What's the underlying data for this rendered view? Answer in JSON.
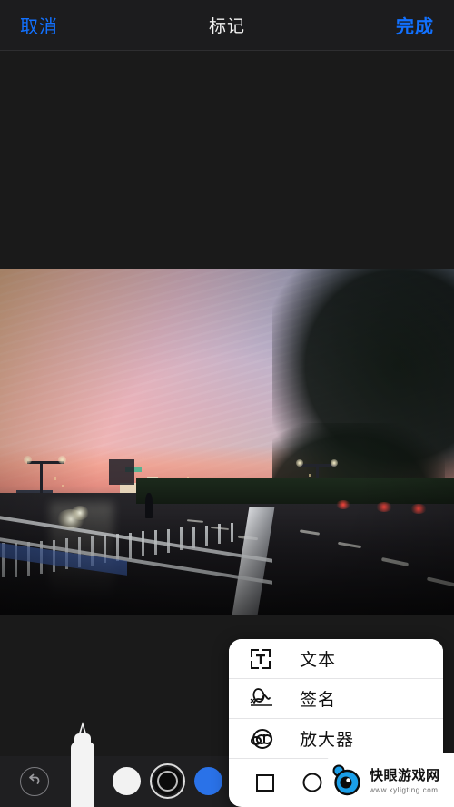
{
  "header": {
    "cancel_label": "取消",
    "title": "标记",
    "done_label": "完成",
    "accent_color": "#1271ff",
    "background": "#1c1c1e"
  },
  "popup_menu": {
    "items": [
      {
        "label": "文本",
        "icon": "text-box-icon"
      },
      {
        "label": "签名",
        "icon": "signature-icon"
      },
      {
        "label": "放大器",
        "icon": "magnifier-icon"
      }
    ],
    "shapes": [
      {
        "name": "square-shape",
        "icon": "square-icon"
      },
      {
        "name": "circle-shape",
        "icon": "circle-icon"
      },
      {
        "name": "speech-bubble-shape",
        "icon": "speech-bubble-icon"
      },
      {
        "name": "arrow-shape",
        "icon": "arrow-icon"
      }
    ]
  },
  "toolbar": {
    "undo_icon": "undo-arrow-icon",
    "pen_tool": "marker-pen-icon",
    "colors": [
      {
        "name": "white",
        "hex": "#f2f2f2",
        "selected": false
      },
      {
        "name": "black",
        "hex": "#0b0b0b",
        "selected": true
      },
      {
        "name": "blue",
        "hex": "#2a72e8",
        "selected": false
      },
      {
        "name": "green",
        "hex": "#4dc45e",
        "selected": false
      },
      {
        "name": "yellow",
        "hex": "#f0c420",
        "selected": false
      },
      {
        "name": "red",
        "hex": "#ee3346",
        "selected": false
      }
    ]
  },
  "watermark": {
    "title": "快眼游戏网",
    "url": "www.kyligting.com",
    "logo_color": "#1a9ee8"
  },
  "photo": {
    "description": "城市黄昏街景照片",
    "alt": "sunset-city-street-photo"
  }
}
